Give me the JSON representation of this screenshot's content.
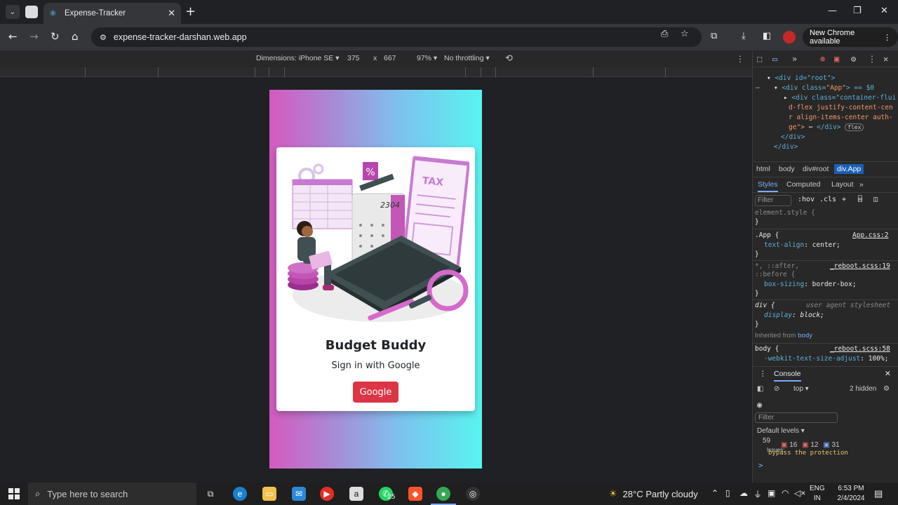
{
  "browser": {
    "tab_title": "Expense-Tracker",
    "url": "expense-tracker-darshan.web.app",
    "new_chrome_label": "New Chrome available"
  },
  "device_toolbar": {
    "dimensions_label": "Dimensions: iPhone SE",
    "width": "375",
    "times": "x",
    "height": "667",
    "zoom": "97%",
    "throttling": "No throttling"
  },
  "app": {
    "title": "Budget Buddy",
    "subtitle": "Sign in with Google",
    "google_button": "Google",
    "illustration": {
      "tax_label": "TAX",
      "number": "2304",
      "percent": "%"
    }
  },
  "devtools": {
    "elements": {
      "line1_tag": "<div id=\"root\">",
      "line2_a": "<div class=",
      "line2_val": "\"App\"",
      "line2_b": "> == $0",
      "line3": "<div class=\"container-flui",
      "line4": "d-flex justify-content-cen",
      "line5": "r align-items-center auth-",
      "line6_a": "ge\">",
      "line6_b": "</div>",
      "flex_badge": "flex",
      "line7": "</div>",
      "line8": "</div>"
    },
    "breadcrumbs": [
      "html",
      "body",
      "div#root",
      "div.App"
    ],
    "subtabs": [
      "Styles",
      "Computed",
      "Layout"
    ],
    "filter_placeholder": "Filter",
    "hov": ":hov",
    "cls": ".cls",
    "styles": {
      "element_style": "element.style {",
      "close": "}",
      "app_sel": ".App {",
      "app_src": "App.css:2",
      "app_prop": "text-align",
      "app_val": "center;",
      "star_sel": "*, ::after,",
      "star_sel2": "::before {",
      "star_src": "_reboot.scss:19",
      "star_prop": "box-sizing",
      "star_val": "border-box;",
      "div_sel": "div {",
      "div_src": "user agent stylesheet",
      "div_prop": "display",
      "div_val": "block;",
      "inherited": "Inherited from",
      "inherited_from": "body",
      "body_sel": "body {",
      "body_src": "_reboot.scss:58",
      "body_prop": "-webkit-text-size-adjust",
      "body_val": "100%;"
    },
    "console": {
      "title": "Console",
      "context": "top",
      "hidden": "2 hidden",
      "filter": "Filter",
      "default_levels": "Default levels",
      "issues_count": "59",
      "issues_label": "Issues:",
      "errors": "16",
      "warnings": "12",
      "info": "31",
      "bypass": "bypass the protection",
      "prompt": ">"
    }
  },
  "taskbar": {
    "search_placeholder": "Type here to search",
    "whatsapp_badge": "25",
    "weather": "28°C  Partly cloudy",
    "lang_line1": "ENG",
    "lang_line2": "IN",
    "time": "6:53 PM",
    "date": "2/4/2024"
  }
}
